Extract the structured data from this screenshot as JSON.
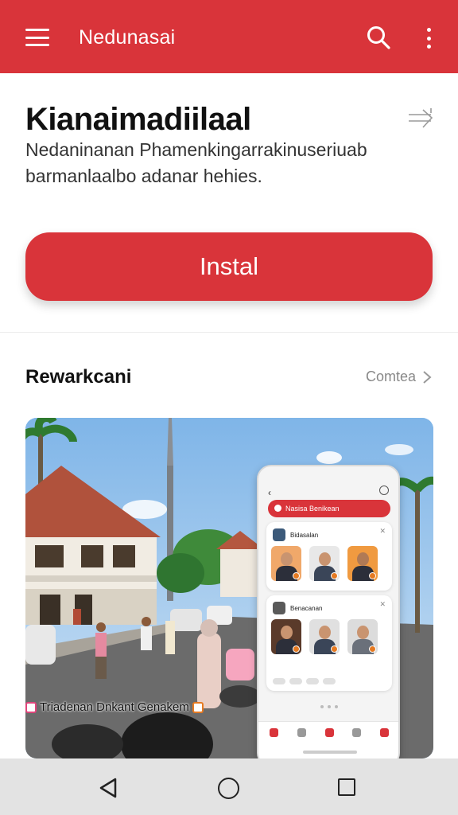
{
  "appbar": {
    "title": "Nedunasai",
    "icons": [
      "menu-icon",
      "search-icon",
      "more-vert-icon"
    ],
    "color": "#d9343a"
  },
  "app": {
    "headline": "Kianaimadiilaal",
    "description": "Nedaninanan Phamenkingarrakinuseriuab barmanlaalbo adanar hehies.",
    "install_label": "Instal"
  },
  "section": {
    "title": "Rewarkcani",
    "link_label": "Comtea"
  },
  "preview": {
    "caption": "Triadenan Dnkant Genakem",
    "phone": {
      "search_text": "Nasisa Benikean",
      "card1_title": "Bidasalan",
      "card2_title": "Benacanan"
    }
  },
  "colors": {
    "accent": "#d9343a",
    "nav_bar": "#e3e3e3"
  }
}
